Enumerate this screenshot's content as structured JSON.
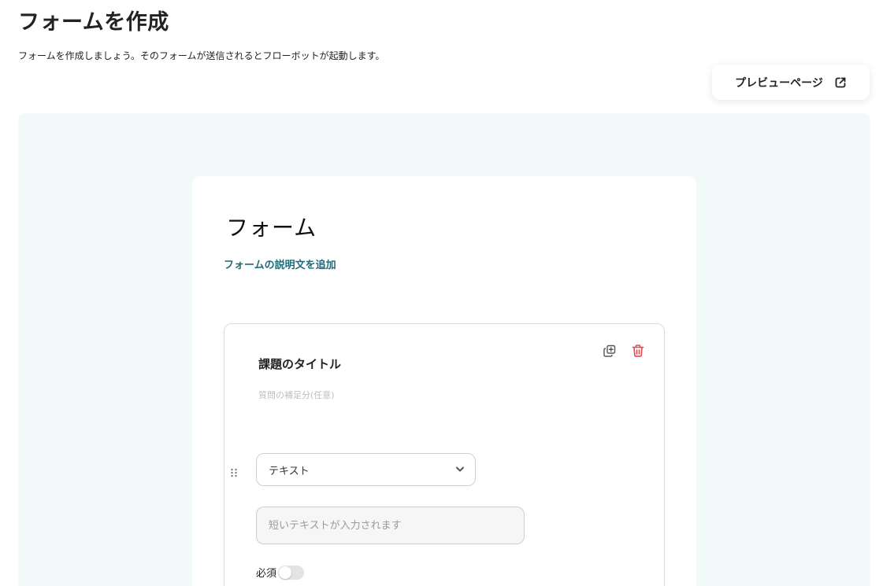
{
  "header": {
    "title": "フォームを作成",
    "description": "フォームを作成しましょう。そのフォームが送信されるとフローボットが起動します。"
  },
  "toolbar": {
    "preview_label": "プレビューページ",
    "preview_icon": "external-link-icon"
  },
  "form": {
    "title": "フォーム",
    "add_description_label": "フォームの説明文を追加"
  },
  "question": {
    "title": "課題のタイトル",
    "supplement_placeholder": "質問の補足分(任意)",
    "type_selected": "テキスト",
    "answer_placeholder": "短いテキストが入力されます",
    "required_label": "必須",
    "required_on": false,
    "icons": {
      "copy": "duplicate-icon",
      "delete": "trash-icon",
      "drag": "drag-handle-icon",
      "dropdown": "chevron-down-icon"
    }
  },
  "colors": {
    "canvas_bg": "#f1faf9",
    "link": "#1e6b7a",
    "delete": "#e5484d",
    "toggle_off": "#e3e3e3"
  }
}
